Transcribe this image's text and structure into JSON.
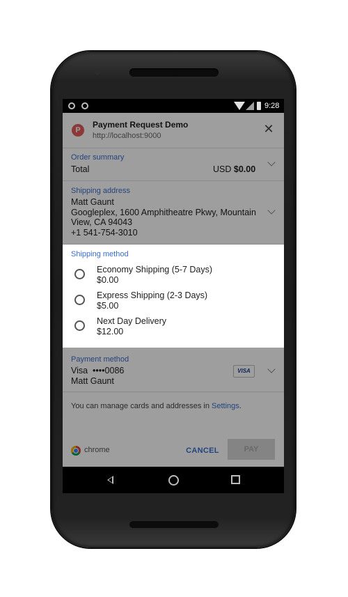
{
  "status_bar": {
    "time": "9:28"
  },
  "header": {
    "title": "Payment Request Demo",
    "origin": "http://localhost:9000",
    "logo_letter": "P",
    "close_icon": "close-icon"
  },
  "order_summary": {
    "label": "Order summary",
    "total_label": "Total",
    "currency": "USD",
    "amount": "$0.00"
  },
  "shipping_address": {
    "label": "Shipping address",
    "name": "Matt Gaunt",
    "line1": "Googleplex, 1600 Amphitheatre Pkwy, Mountain",
    "line2": "View, CA 94043",
    "phone": "+1 541-754-3010"
  },
  "shipping_method": {
    "label": "Shipping method",
    "options": [
      {
        "name": "Economy Shipping (5-7 Days)",
        "price": "$0.00"
      },
      {
        "name": "Express Shipping (2-3 Days)",
        "price": "$5.00"
      },
      {
        "name": "Next Day Delivery",
        "price": "$12.00"
      }
    ]
  },
  "payment_method": {
    "label": "Payment method",
    "card": "Visa  ••••0086",
    "holder": "Matt Gaunt",
    "card_brand": "VISA"
  },
  "manage": {
    "text": "You can manage cards and addresses in ",
    "link": "Settings",
    "suffix": "."
  },
  "footer": {
    "brand": "chrome",
    "cancel": "CANCEL",
    "pay": "PAY"
  },
  "colors": {
    "accent": "#3a6ecc",
    "logo_red": "#e35b5b"
  }
}
